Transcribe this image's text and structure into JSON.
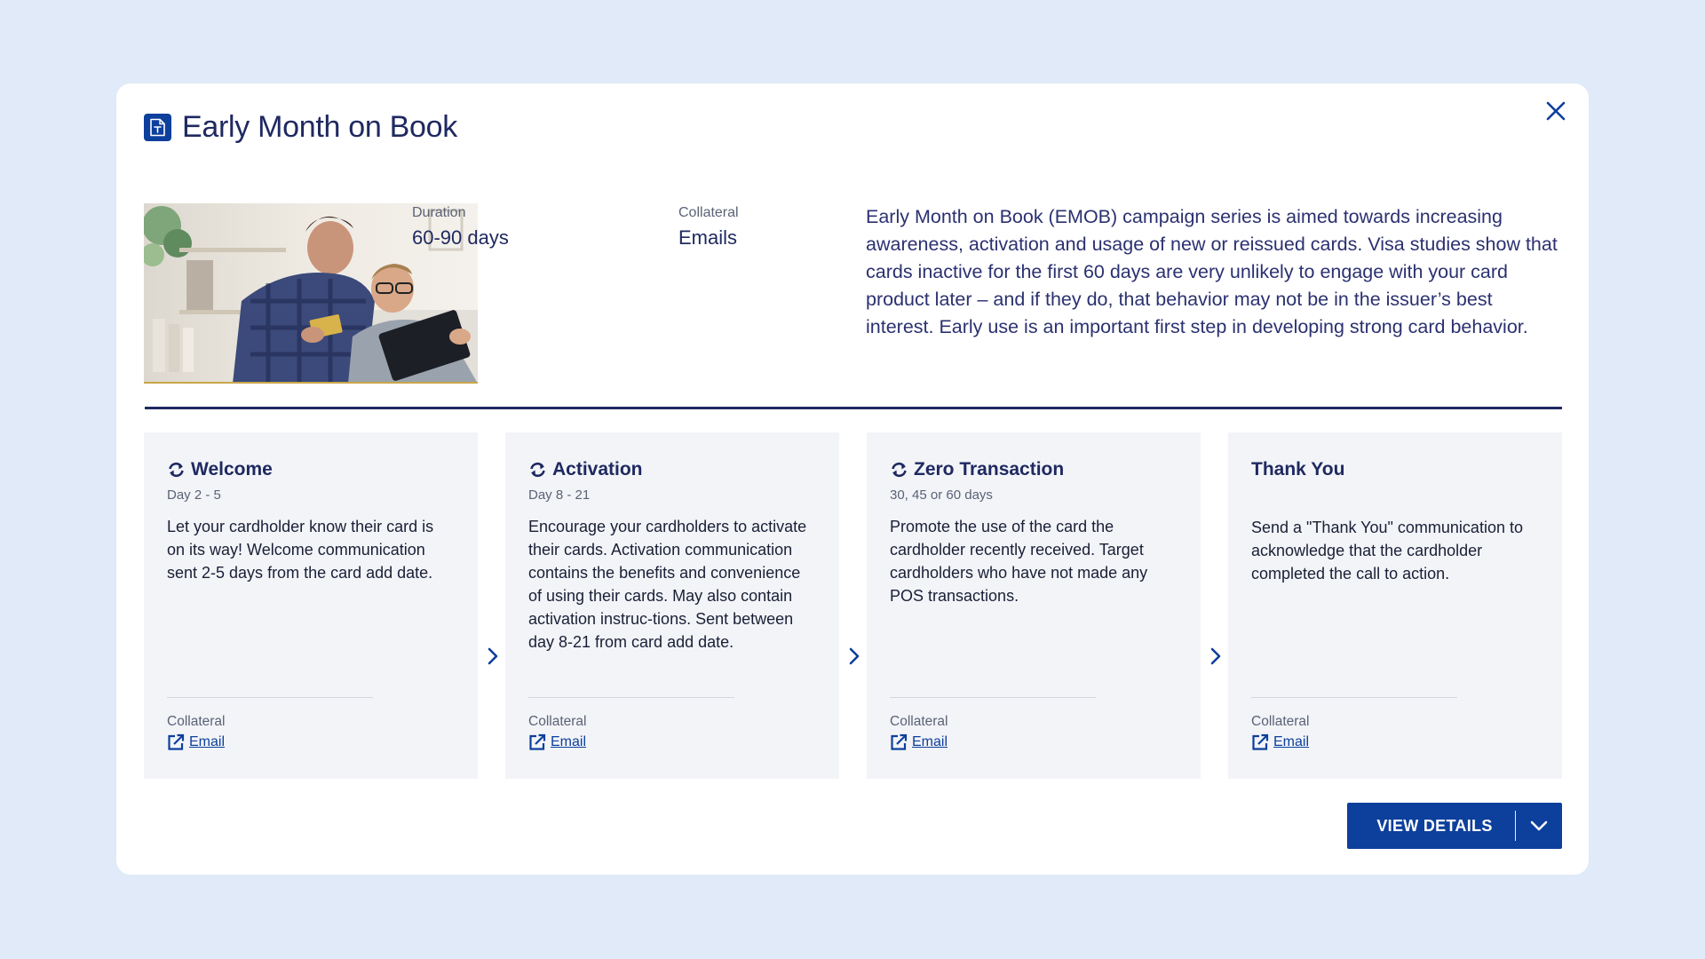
{
  "modal": {
    "title": "Early Month on Book",
    "icon": "document-icon",
    "close_icon": "close-icon"
  },
  "overview": {
    "image_alt": "two men looking at a tablet with a credit card",
    "duration_label": "Duration",
    "duration_value": "60-90 days",
    "collateral_label": "Collateral",
    "collateral_value": "Emails",
    "description": "Early Month on Book (EMOB) campaign series is aimed towards increasing awareness, activation and usage of new or reissued cards. Visa studies show that cards inactive for the first 60 days are very unlikely to engage with your card product later – and if they do, that behavior may not be in the issuer’s best interest. Early use is an important first step in developing strong card behavior."
  },
  "steps": [
    {
      "title": "Welcome",
      "icon": "refresh-icon",
      "day": "Day 2 - 5",
      "body": "Let your cardholder know their card is on its way! Welcome communication sent 2-5 days from the card add date.",
      "collateral_label": "Collateral",
      "link_label": "Email"
    },
    {
      "title": "Activation",
      "icon": "refresh-icon",
      "day": "Day 8 - 21",
      "body": "Encourage your cardholders to activate their cards. Activation communication contains the benefits and convenience of using their cards. May also contain activation instruc-tions. Sent between day 8-21 from card add date.",
      "collateral_label": "Collateral",
      "link_label": "Email"
    },
    {
      "title": "Zero Transaction",
      "icon": "refresh-icon",
      "day": "30, 45 or 60 days",
      "body": "Promote the use of the card the cardholder recently received. Target cardholders who have not made any POS transactions.",
      "collateral_label": "Collateral",
      "link_label": "Email"
    },
    {
      "title": "Thank You",
      "day": "",
      "body": "Send a \"Thank You\" communication to acknowledge that the cardholder completed the call to action.",
      "collateral_label": "Collateral",
      "link_label": "Email"
    }
  ],
  "footer": {
    "view_details_label": "VIEW DETAILS"
  },
  "colors": {
    "page_bg": "#e0eaf8",
    "brand_blue": "#0d3f9c",
    "title_navy": "#1f2960",
    "card_bg": "#f2f4f8"
  }
}
